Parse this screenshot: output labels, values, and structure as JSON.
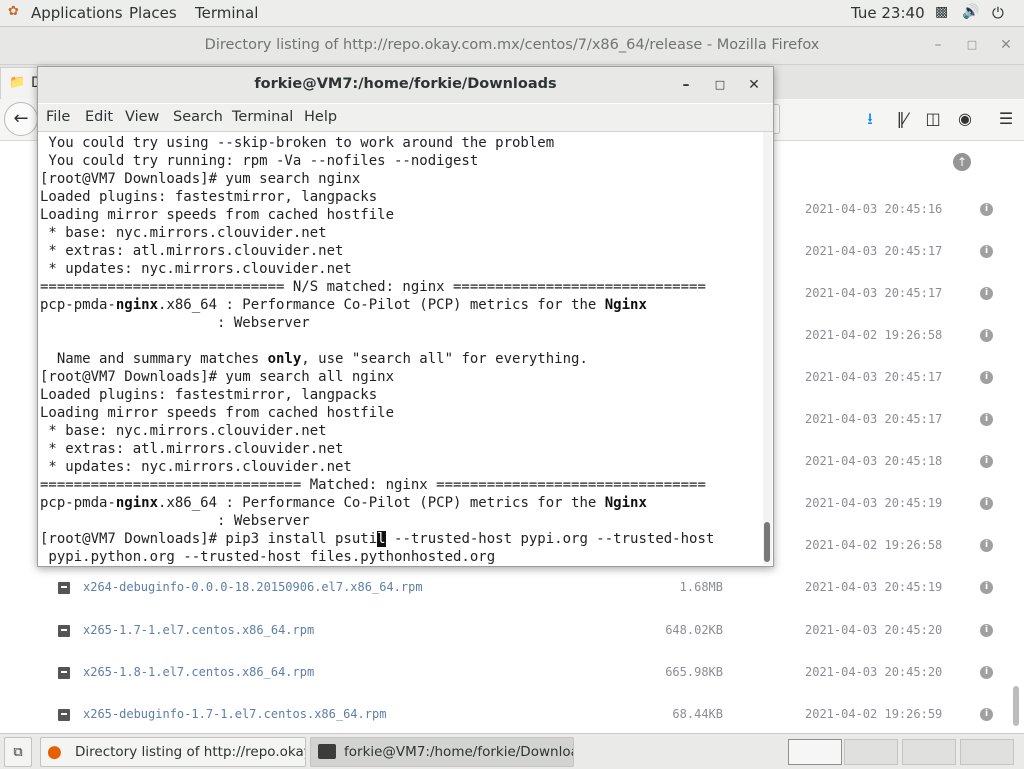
{
  "top_panel": {
    "applications": "Applications",
    "places": "Places",
    "terminal": "Terminal",
    "clock": "Tue 23:40",
    "icons": [
      "network-icon",
      "volume-icon",
      "power-icon"
    ]
  },
  "firefox": {
    "title": "Directory listing of http://repo.okay.com.mx/centos/7/x86_64/release - Mozilla Firefox",
    "tab_label_partial": "D",
    "rows": [
      {
        "name": "",
        "size": "",
        "date": "2021-04-03 20:45:16"
      },
      {
        "name": "",
        "size": "",
        "date": "2021-04-03 20:45:17"
      },
      {
        "name": "",
        "size": "",
        "date": "2021-04-03 20:45:17"
      },
      {
        "name": "",
        "size": "",
        "date": "2021-04-02 19:26:58"
      },
      {
        "name": "",
        "size": "",
        "date": "2021-04-03 20:45:17"
      },
      {
        "name": "",
        "size": "",
        "date": "2021-04-03 20:45:17"
      },
      {
        "name": "",
        "size": "",
        "date": "2021-04-03 20:45:18"
      },
      {
        "name": "",
        "size": "",
        "date": "2021-04-03 20:45:19"
      },
      {
        "name": "",
        "size": "",
        "date": "2021-04-02 19:26:58"
      },
      {
        "name": "x264-debuginfo-0.0.0-18.20150906.el7.x86_64.rpm",
        "size": "1.68MB",
        "date": "2021-04-03 20:45:19"
      },
      {
        "name": "x265-1.7-1.el7.centos.x86_64.rpm",
        "size": "648.02KB",
        "date": "2021-04-03 20:45:20"
      },
      {
        "name": "x265-1.8-1.el7.centos.x86_64.rpm",
        "size": "665.98KB",
        "date": "2021-04-03 20:45:20"
      },
      {
        "name": "x265-debuginfo-1.7-1.el7.centos.x86_64.rpm",
        "size": "68.44KB",
        "date": "2021-04-02 19:26:59"
      }
    ]
  },
  "terminal": {
    "title": "forkie@VM7:/home/forkie/Downloads",
    "menu": [
      "File",
      "Edit",
      "View",
      "Search",
      "Terminal",
      "Help"
    ],
    "lines": [
      [
        {
          "t": " You could try using --skip-broken to work around the problem"
        }
      ],
      [
        {
          "t": " You could try running: rpm -Va --nofiles --nodigest"
        }
      ],
      [
        {
          "t": "[root@VM7 Downloads]# yum search nginx"
        }
      ],
      [
        {
          "t": "Loaded plugins: fastestmirror, langpacks"
        }
      ],
      [
        {
          "t": "Loading mirror speeds from cached hostfile"
        }
      ],
      [
        {
          "t": " * base: nyc.mirrors.clouvider.net"
        }
      ],
      [
        {
          "t": " * extras: atl.mirrors.clouvider.net"
        }
      ],
      [
        {
          "t": " * updates: nyc.mirrors.clouvider.net"
        }
      ],
      [
        {
          "t": "============================= N/S matched: nginx =============================="
        }
      ],
      [
        {
          "t": "pcp-pmda-"
        },
        {
          "t": "nginx",
          "b": true
        },
        {
          "t": ".x86_64 : Performance Co-Pilot (PCP) metrics for the "
        },
        {
          "t": "Nginx",
          "b": true
        }
      ],
      [
        {
          "t": "                     : Webserver"
        }
      ],
      [
        {
          "t": ""
        }
      ],
      [
        {
          "t": "  Name and summary matches "
        },
        {
          "t": "only",
          "b": true
        },
        {
          "t": ", use \"search all\" for everything."
        }
      ],
      [
        {
          "t": "[root@VM7 Downloads]# yum search all nginx"
        }
      ],
      [
        {
          "t": "Loaded plugins: fastestmirror, langpacks"
        }
      ],
      [
        {
          "t": "Loading mirror speeds from cached hostfile"
        }
      ],
      [
        {
          "t": " * base: nyc.mirrors.clouvider.net"
        }
      ],
      [
        {
          "t": " * extras: atl.mirrors.clouvider.net"
        }
      ],
      [
        {
          "t": " * updates: nyc.mirrors.clouvider.net"
        }
      ],
      [
        {
          "t": "=============================== Matched: nginx ================================"
        }
      ],
      [
        {
          "t": "pcp-pmda-"
        },
        {
          "t": "nginx",
          "b": true
        },
        {
          "t": ".x86_64 : Performance Co-Pilot (PCP) metrics for the "
        },
        {
          "t": "Nginx",
          "b": true
        }
      ],
      [
        {
          "t": "                     : Webserver"
        }
      ],
      [
        {
          "t": "[root@VM7 Downloads]# pip3 install psuti"
        },
        {
          "t": "l",
          "c": true
        },
        {
          "t": " --trusted-host pypi.org --trusted-host"
        }
      ],
      [
        {
          "t": " pypi.python.org --trusted-host files.pythonhosted.org"
        }
      ]
    ]
  },
  "taskbar": {
    "firefox_task": "Directory listing of http://repo.okay....",
    "terminal_task": "forkie@VM7:/home/forkie/Downloa..."
  }
}
